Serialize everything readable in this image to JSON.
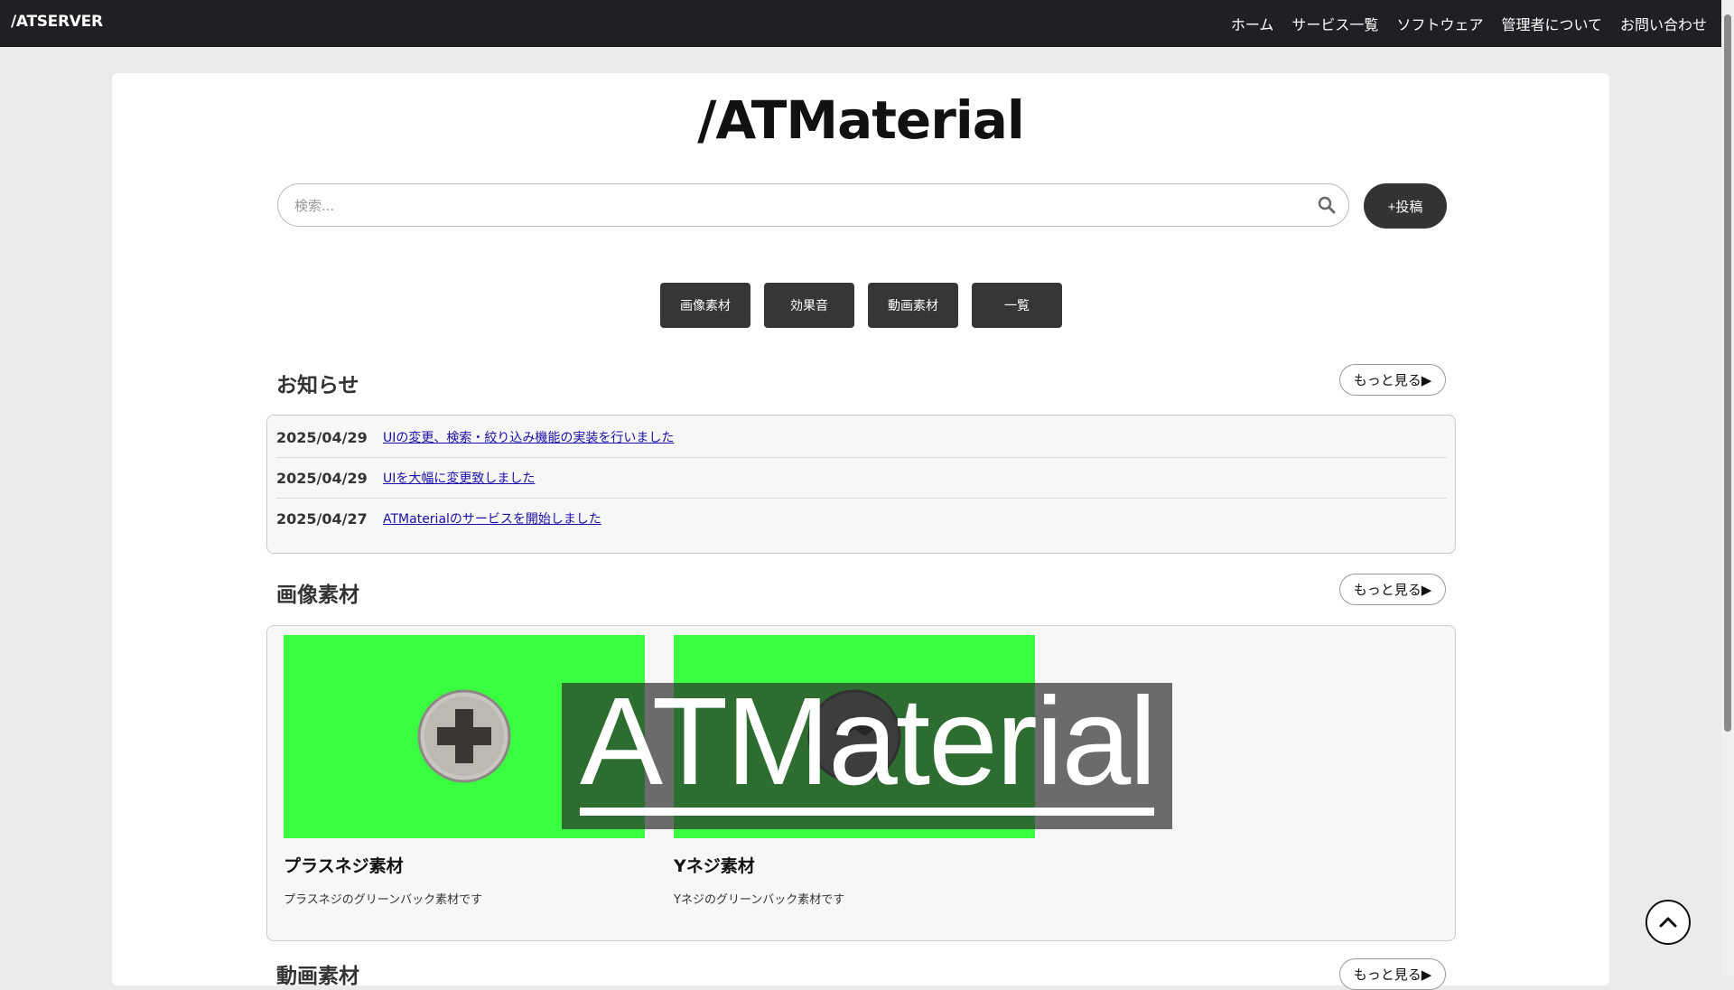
{
  "navbar": {
    "brand": "/ATSERVER",
    "links": [
      "ホーム",
      "サービス一覧",
      "ソフトウェア",
      "管理者について",
      "お問い合わせ"
    ]
  },
  "site_title": "/ATMaterial",
  "search": {
    "placeholder": "検索..."
  },
  "post_button": "+投稿",
  "categories": [
    "画像素材",
    "効果音",
    "動画素材",
    "一覧"
  ],
  "news": {
    "title": "お知らせ",
    "more": "もっと見る▶",
    "items": [
      {
        "date": "2025/04/29",
        "text": "UIの変更、検索・絞り込み機能の実装を行いました"
      },
      {
        "date": "2025/04/29",
        "text": "UIを大幅に変更致しました"
      },
      {
        "date": "2025/04/27",
        "text": "ATMaterialのサービスを開始しました"
      }
    ]
  },
  "images": {
    "title": "画像素材",
    "more": "もっと見る▶",
    "items": [
      {
        "title": "プラスネジ素材",
        "desc": "プラスネジのグリーンバック素材です"
      },
      {
        "title": "Yネジ素材",
        "desc": "Yネジのグリーンバック素材です"
      }
    ]
  },
  "videos": {
    "title": "動画素材",
    "more": "もっと見る▶"
  },
  "watermark": "ATMaterial",
  "colors": {
    "navbar": "#1f2023",
    "greenback": "#39ff40",
    "button_dark": "#363636",
    "link": "#1a0dab"
  }
}
